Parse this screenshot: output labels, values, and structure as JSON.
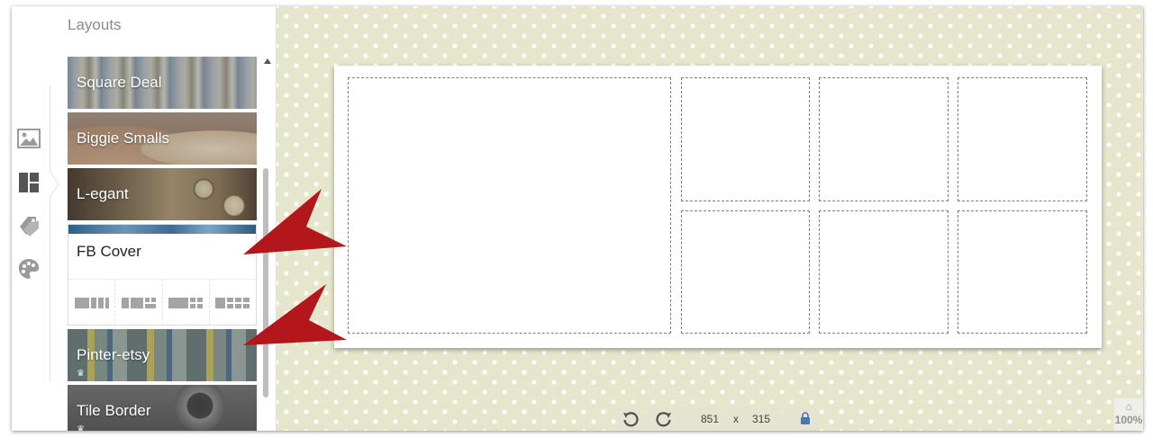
{
  "panel": {
    "title": "Layouts",
    "tiles_top": [
      {
        "label": "Square Deal"
      },
      {
        "label": "Biggie Smalls"
      },
      {
        "label": "L-egant"
      }
    ],
    "open_tile": {
      "label": "FB Cover"
    },
    "tiles_bottom": [
      {
        "label": "Pinter-etsy",
        "crown": "♛"
      },
      {
        "label": "Tile Border",
        "crown": "♛"
      }
    ]
  },
  "rail": {
    "icons": [
      "image-icon",
      "layout-icon",
      "tag-icon",
      "palette-icon"
    ]
  },
  "canvas": {
    "width_value": "851",
    "times": "x",
    "height_value": "315",
    "zoom": "100%",
    "zoom_caret": "⌂"
  },
  "colors": {
    "canvas_bg": "#e6e6cd",
    "arrow": "#b3161b",
    "active_icon": "#555555",
    "icon": "#9a9a9a"
  }
}
